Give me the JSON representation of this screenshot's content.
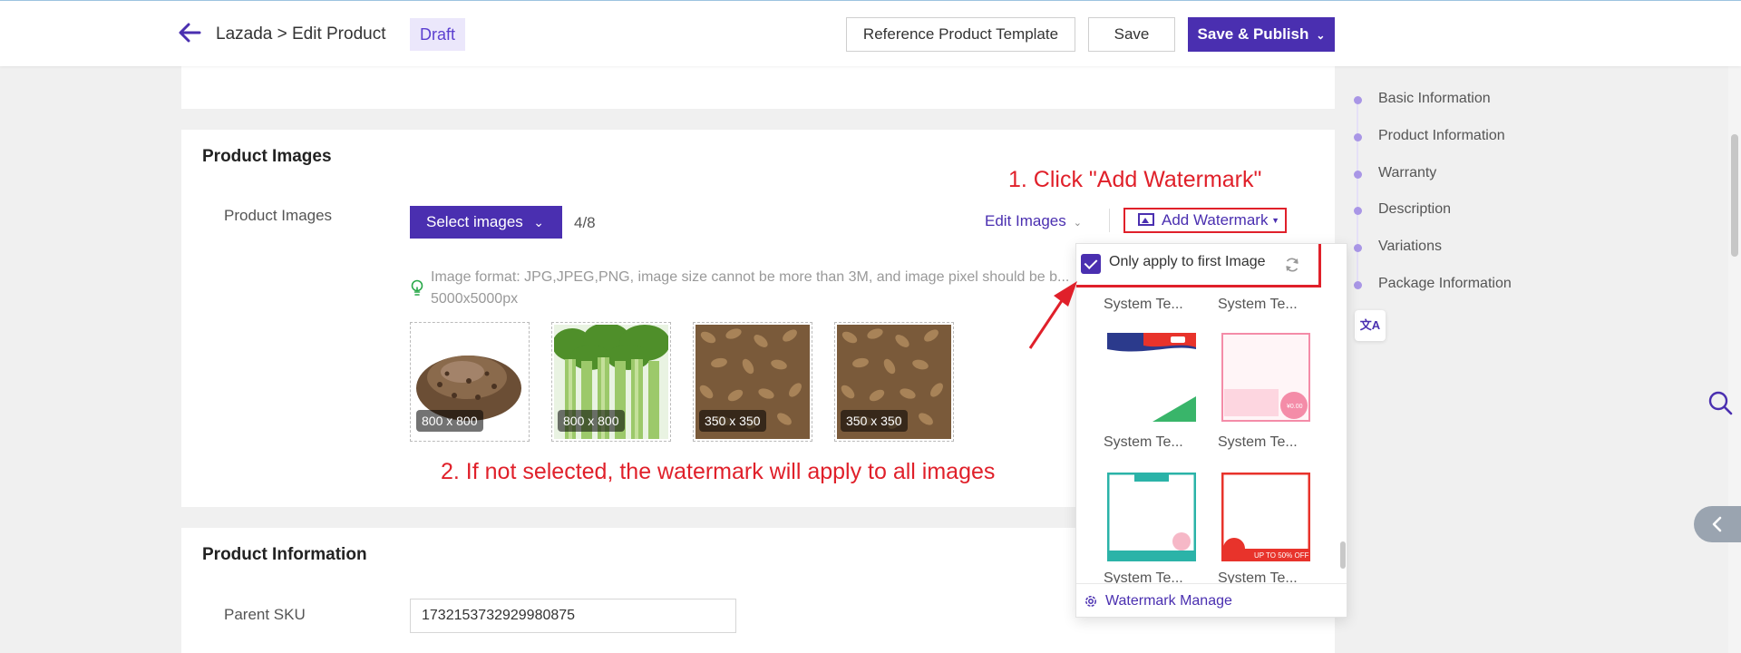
{
  "header": {
    "breadcrumb": "Lazada > Edit Product",
    "status_badge": "Draft",
    "btn_reference": "Reference Product Template",
    "btn_save": "Save",
    "btn_publish": "Save & Publish"
  },
  "images_section": {
    "title": "Product Images",
    "field_label": "Product Images",
    "select_button": "Select images",
    "count": "4/8",
    "edit_images": "Edit Images",
    "add_watermark": "Add Watermark",
    "hint": "Image format: JPG,JPEG,PNG, image size cannot be more than 3M, and image pixel should be b... 5000x5000px",
    "thumbnails": [
      {
        "size": "800 x 800",
        "subject": "dried seeds pile"
      },
      {
        "size": "800 x 800",
        "subject": "celery stalks"
      },
      {
        "size": "350 x 350",
        "subject": "seeds closeup"
      },
      {
        "size": "350 x 350",
        "subject": "seeds closeup"
      }
    ]
  },
  "watermark_dropdown": {
    "only_first_label": "Only apply to first Image",
    "only_first_checked": true,
    "templates": [
      "System Te...",
      "System Te...",
      "System Te...",
      "System Te...",
      "System Te...",
      "System Te..."
    ],
    "footer": "Watermark Manage"
  },
  "annotations": {
    "step1": "1. Click \"Add Watermark\"",
    "step2": "2. If not selected, the watermark will apply to all images"
  },
  "info_section": {
    "title": "Product Information",
    "parent_sku_label": "Parent SKU",
    "parent_sku_value": "1732153732929980875"
  },
  "right_nav": {
    "items": [
      "Basic Information",
      "Product Information",
      "Warranty",
      "Description",
      "Variations",
      "Package Information"
    ],
    "translate_label": "文A"
  },
  "colors": {
    "primary": "#4a2fb0",
    "annotation": "#e0202a",
    "badge_bg": "#ebe7fb"
  }
}
